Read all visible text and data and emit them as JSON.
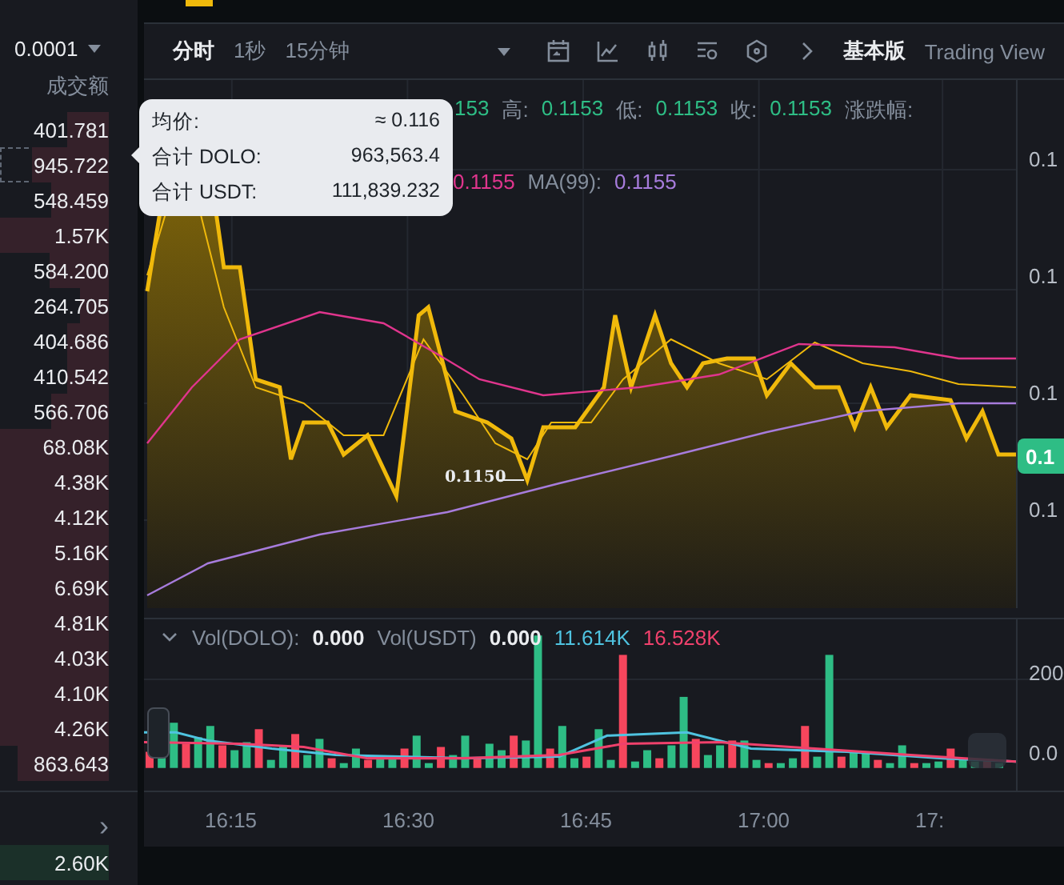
{
  "left_panel": {
    "precision": "0.0001",
    "column_title": "成交额",
    "rows": [
      {
        "value": "401.781",
        "kind": "sell",
        "level": 0.38
      },
      {
        "value": "945.722",
        "kind": "sell",
        "level": 0.7,
        "hovered": true
      },
      {
        "value": "548.459",
        "kind": "sell",
        "level": 0.53
      },
      {
        "value": "1.57K",
        "kind": "sell",
        "level": 1
      },
      {
        "value": "584.200",
        "kind": "sell",
        "level": 0.55
      },
      {
        "value": "264.705",
        "kind": "sell",
        "level": 0.26
      },
      {
        "value": "404.686",
        "kind": "sell",
        "level": 0.38
      },
      {
        "value": "410.542",
        "kind": "sell",
        "level": 0.38
      },
      {
        "value": "566.706",
        "kind": "sell",
        "level": 0.53
      },
      {
        "value": "68.08K",
        "kind": "sell",
        "level": 1
      },
      {
        "value": "4.38K",
        "kind": "sell",
        "level": 1
      },
      {
        "value": "4.12K",
        "kind": "sell",
        "level": 1
      },
      {
        "value": "5.16K",
        "kind": "sell",
        "level": 1
      },
      {
        "value": "6.69K",
        "kind": "sell",
        "level": 1
      },
      {
        "value": "4.81K",
        "kind": "sell",
        "level": 1
      },
      {
        "value": "4.03K",
        "kind": "sell",
        "level": 1
      },
      {
        "value": "4.10K",
        "kind": "sell",
        "level": 1
      },
      {
        "value": "4.26K",
        "kind": "sell",
        "level": 1
      },
      {
        "value": "863.643",
        "kind": "sell",
        "level": 0.84
      }
    ],
    "more": "›",
    "bottom_row": {
      "value": "2.60K",
      "kind": "buy",
      "level": 1
    }
  },
  "toolbar": {
    "intervals": [
      {
        "label": "分时",
        "selected": true
      },
      {
        "label": "1秒",
        "selected": false
      },
      {
        "label": "15分钟",
        "selected": false
      }
    ],
    "views": [
      {
        "label": "基本版",
        "selected": true
      },
      {
        "label": "Trading View",
        "selected": false
      }
    ]
  },
  "legend_1": [
    {
      "value": "153"
    },
    {
      "label": "高:",
      "value": "0.1153"
    },
    {
      "label": "低:",
      "value": "0.1153"
    },
    {
      "label": "收:",
      "value": "0.1153"
    },
    {
      "label": "涨跌幅:"
    }
  ],
  "legend_2": [
    {
      "value": "0.1155",
      "color": "#e0358d"
    },
    {
      "label": "MA(99):",
      "value": "0.1155",
      "color": "#a77cdc"
    }
  ],
  "tooltip": {
    "rows": [
      {
        "label": "均价:",
        "value": "≈ 0.116"
      },
      {
        "label": "合计 DOLO:",
        "value": "963,563.4"
      },
      {
        "label": "合计 USDT:",
        "value": "111,839.232"
      }
    ]
  },
  "price_axis": [
    "0.1",
    "0.1",
    "0.1",
    "0.1"
  ],
  "last_price": "0.1",
  "low_marker": "0.1150",
  "volume_legend": [
    {
      "label": "Vol(DOLO):",
      "value": "0.000",
      "color": "#eaecef"
    },
    {
      "label": "Vol(USDT)",
      "value": "0.000",
      "color": "#eaecef"
    },
    {
      "value": "11.614K",
      "color": "#4fc3e0"
    },
    {
      "value": "16.528K",
      "color": "#f0416c"
    }
  ],
  "volume_axis": [
    "200",
    "0.0"
  ],
  "time_axis": [
    "16:15",
    "16:30",
    "16:45",
    "17:00",
    "17:"
  ]
}
